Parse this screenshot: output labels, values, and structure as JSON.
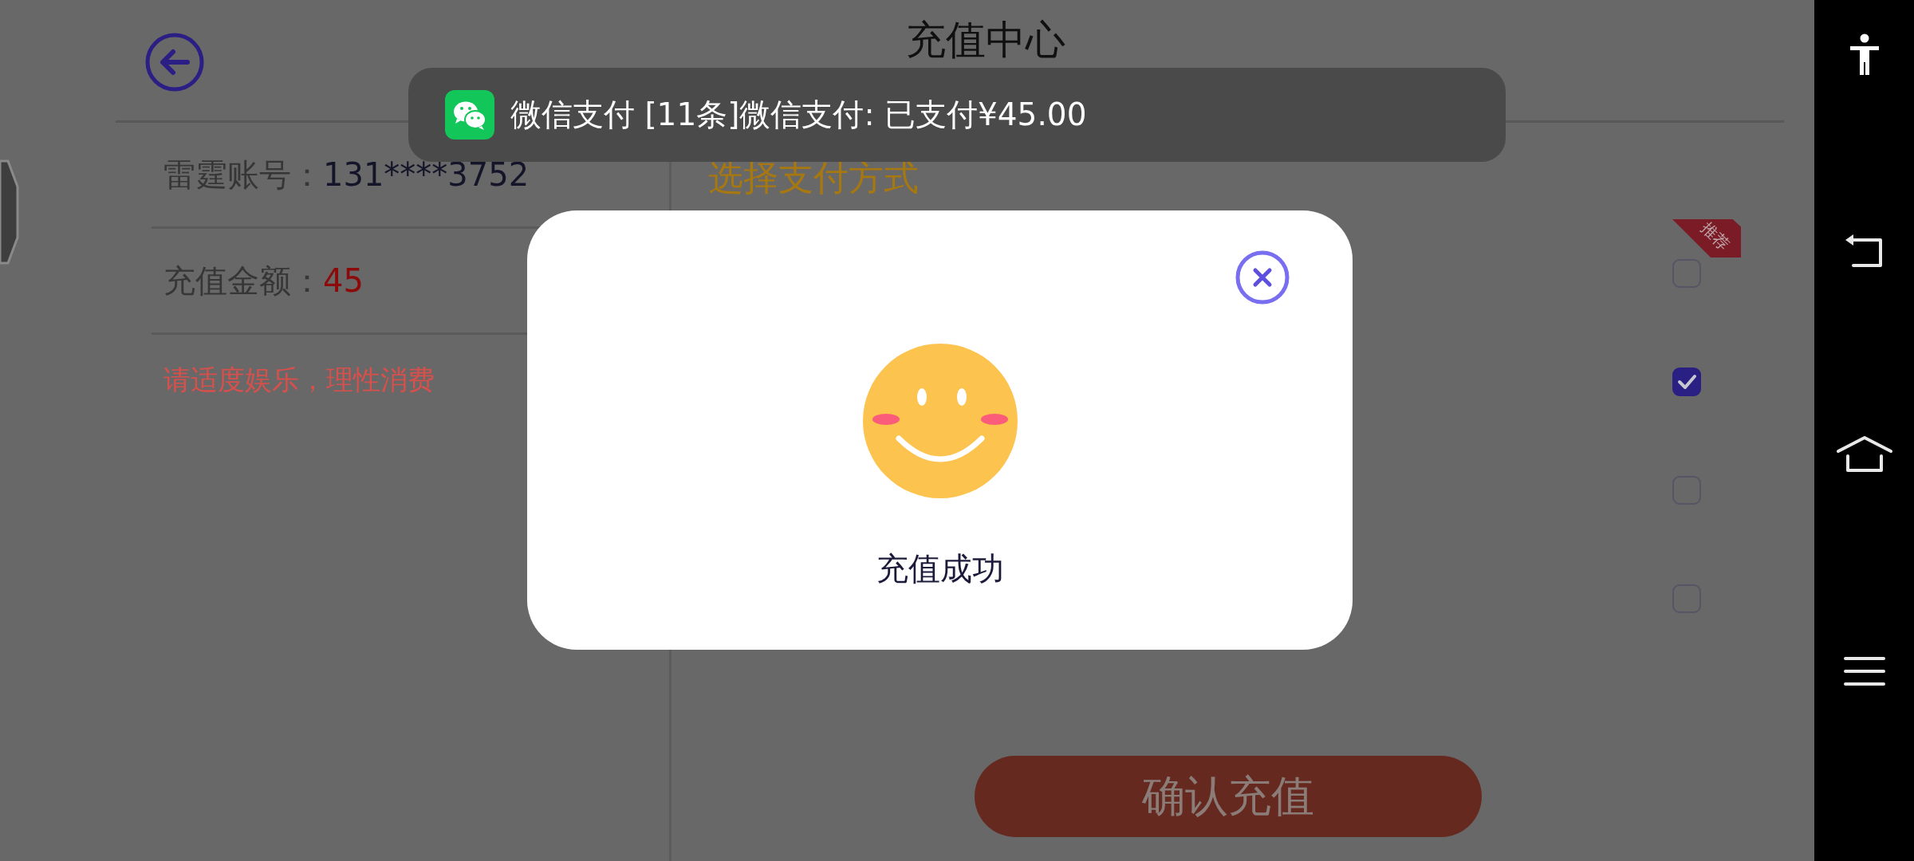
{
  "header": {
    "title": "充值中心"
  },
  "account": {
    "label": "雷霆账号：",
    "value": "131****3752"
  },
  "amount": {
    "label": "充值金额：",
    "value": "45"
  },
  "notice": "请适度娱乐，理性消费",
  "payment": {
    "heading": "选择支付方式",
    "options": [
      {
        "checked": false,
        "badge": "推荐"
      },
      {
        "checked": true
      },
      {
        "checked": false
      },
      {
        "checked": false
      }
    ]
  },
  "confirm_button": "确认充值",
  "notification": {
    "text": "微信支付 [11条]微信支付: 已支付¥45.00"
  },
  "dialog": {
    "message": "充值成功"
  }
}
